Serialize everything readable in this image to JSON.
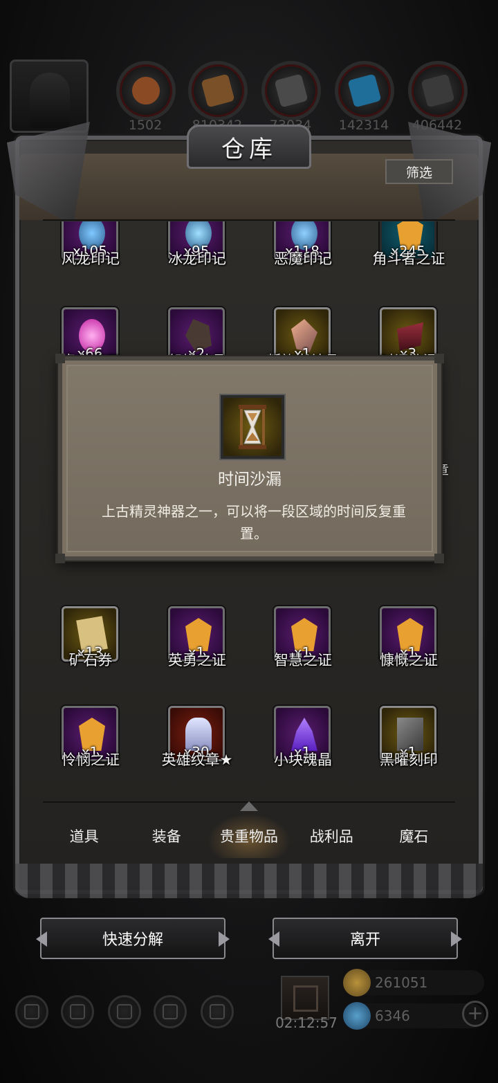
{
  "window": {
    "title": "仓库",
    "filter_label": "筛选"
  },
  "resources": [
    "1502",
    "810342",
    "73034",
    "142314",
    "406442"
  ],
  "items": [
    {
      "name": "风龙印记",
      "count": "x105",
      "rarity": "purple",
      "icon": "wind-dragon-seal-icon",
      "color": "#7fc8ff"
    },
    {
      "name": "冰龙印记",
      "count": "x95",
      "rarity": "purple",
      "icon": "ice-dragon-seal-icon",
      "color": "#9fe0ff"
    },
    {
      "name": "恶魔印记",
      "count": "x118",
      "rarity": "purple",
      "icon": "demon-seal-icon",
      "color": "#8fd0ff"
    },
    {
      "name": "角斗者之证",
      "count": "x245",
      "rarity": "blue",
      "icon": "gladiator-badge-icon",
      "color": "#e8a030"
    },
    {
      "name": "虚空魂石",
      "count": "x66",
      "rarity": "purple",
      "icon": "void-soulstone-icon",
      "color": "#ff5ad8"
    },
    {
      "name": "怨憎结晶",
      "count": "x2",
      "rarity": "purple",
      "icon": "resentment-crystal-icon",
      "color": "#6a5a50"
    },
    {
      "name": "叛族者结晶",
      "count": "x1",
      "rarity": "gold",
      "icon": "traitor-crystal-icon",
      "color": "#e09070"
    },
    {
      "name": "时间沙漏",
      "count": "x3",
      "rarity": "gold",
      "icon": "hourglass-icon",
      "color": "#c04050"
    },
    {
      "name": "矿石券",
      "count": "x13",
      "rarity": "gold",
      "icon": "ore-voucher-icon",
      "color": "#d8c080"
    },
    {
      "name": "英勇之证",
      "count": "x1",
      "rarity": "purple",
      "icon": "valor-badge-icon",
      "color": "#e8a030"
    },
    {
      "name": "智慧之证",
      "count": "x1",
      "rarity": "purple",
      "icon": "wisdom-badge-icon",
      "color": "#e8a030"
    },
    {
      "name": "慷慨之证",
      "count": "x1",
      "rarity": "purple",
      "icon": "generosity-badge-icon",
      "color": "#e8a030"
    },
    {
      "name": "怜悯之证",
      "count": "x1",
      "rarity": "purple",
      "icon": "mercy-badge-icon",
      "color": "#e8a030"
    },
    {
      "name": "英雄纹章★",
      "count": "x30",
      "rarity": "red",
      "icon": "hero-crest-icon",
      "color": "#c8d0f0"
    },
    {
      "name": "小块魂晶",
      "count": "x1",
      "rarity": "purple",
      "icon": "soul-crystal-shard-icon",
      "color": "#8a50f0"
    },
    {
      "name": "黑曜刻印",
      "count": "x1",
      "rarity": "gold",
      "icon": "obsidian-seal-icon",
      "color": "#6a6a6a"
    }
  ],
  "tabs": [
    {
      "label": "道具",
      "active": false
    },
    {
      "label": "装备",
      "active": false
    },
    {
      "label": "贵重物品",
      "active": true
    },
    {
      "label": "战利品",
      "active": false
    },
    {
      "label": "魔石",
      "active": false
    }
  ],
  "actions": {
    "decompose": "快速分解",
    "leave": "离开"
  },
  "hud": {
    "timer": "02:12:57",
    "gold": "261051",
    "gems": "6346"
  },
  "tooltip": {
    "name": "时间沙漏",
    "description": "上古精灵神器之一，可以将一段区域的时间反复重置。",
    "icon": "hourglass-icon"
  },
  "peek": {
    "right_suffix": "章"
  }
}
